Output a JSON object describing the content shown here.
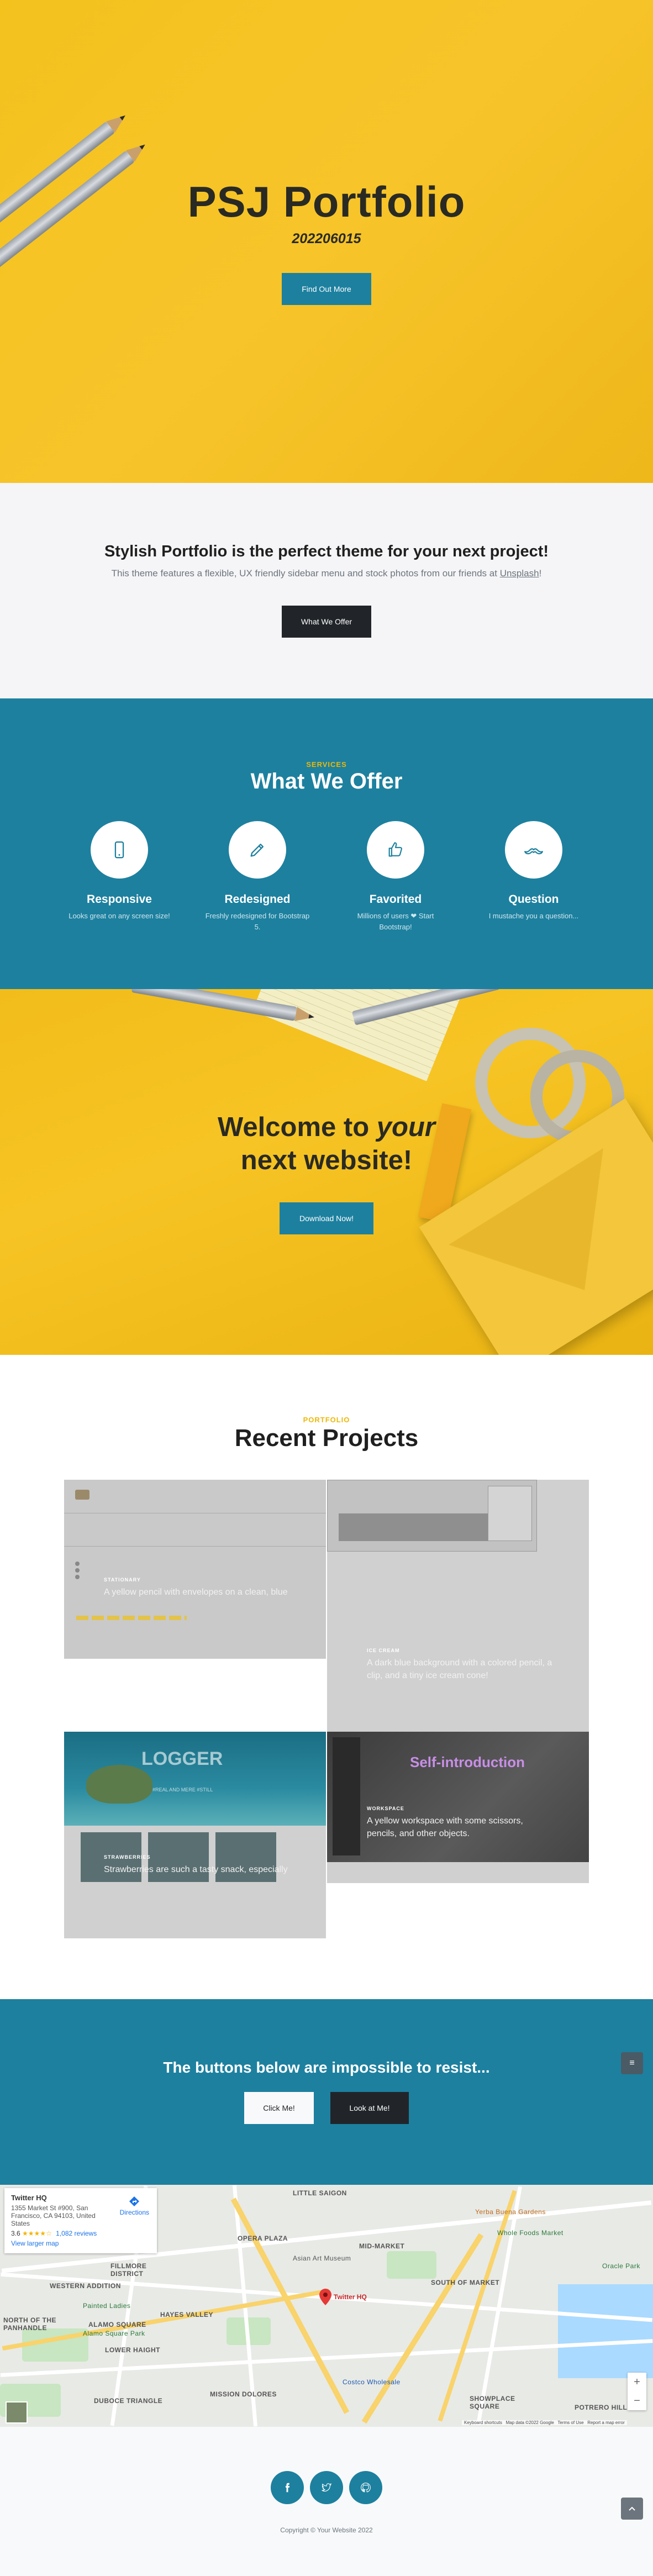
{
  "hero": {
    "title": "PSJ Portfolio",
    "subtitle": "202206015",
    "button": "Find Out More"
  },
  "about": {
    "heading": "Stylish Portfolio is the perfect theme for your next project!",
    "text": "This theme features a flexible, UX friendly sidebar menu and stock photos from our friends at",
    "link": "Unsplash",
    "text_end": "!",
    "button": "What We Offer"
  },
  "services": {
    "eyebrow": "SERVICES",
    "heading": "What We Offer",
    "items": [
      {
        "icon": "phone-icon",
        "title": "Responsive",
        "desc": "Looks great on any screen size!"
      },
      {
        "icon": "pencil-icon",
        "title": "Redesigned",
        "desc": "Freshly redesigned for Bootstrap 5."
      },
      {
        "icon": "thumbs-up-icon",
        "title": "Favorited",
        "desc": "Millions of users ❤ Start Bootstrap!"
      },
      {
        "icon": "mustache-icon",
        "title": "Question",
        "desc": "I mustache you a question..."
      }
    ]
  },
  "callout": {
    "line1": "Welcome to",
    "emph": "your",
    "line2": "next website!",
    "button": "Download Now!"
  },
  "portfolio": {
    "eyebrow": "PORTFOLIO",
    "heading": "Recent Projects",
    "projects": [
      {
        "title": "STATIONARY",
        "desc": "A yellow pencil with envelopes on a clean, blue"
      },
      {
        "title": "ICE CREAM",
        "desc": "A dark blue background with a colored pencil, a clip, and a tiny ice cream cone!"
      },
      {
        "title": "STRAWBERRIES",
        "desc": "Strawberries are such a tasty snack, especially"
      },
      {
        "title": "WORKSPACE",
        "desc": "A yellow workspace with some scissors, pencils, and other objects."
      }
    ],
    "logger_title": "LOGGER",
    "logger_sub": "#REAL AND MERE #STILL",
    "self_intro": "Self-introduction"
  },
  "cta": {
    "heading": "The buttons below are impossible to resist...",
    "button1": "Click Me!",
    "button2": "Look at Me!",
    "menu_icon": "menu-icon"
  },
  "map": {
    "place": "Twitter HQ",
    "address": "1355 Market St #900, San Francisco, CA 94103, United States",
    "rating": "3.6",
    "stars": "★★★★☆",
    "reviews": "1,082 reviews",
    "larger": "View larger map",
    "directions": "Directions",
    "pin_label": "Twitter HQ",
    "footer_text": "Keyboard shortcuts   Map data ©2022 Google   Terms of Use   Report a map error",
    "labels": [
      "LITTLE SAIGON",
      "OPERA PLAZA",
      "MID-MARKET",
      "SOUTH OF MARKET",
      "HAYES VALLEY",
      "ALAMO SQUARE",
      "LOWER HAIGHT",
      "NORTH OF THE PANHANDLE",
      "DUBOCE TRIANGLE",
      "MISSION DOLORES",
      "SHOWPLACE SQUARE",
      "POTRERO HILL",
      "FILLMORE DISTRICT",
      "WESTERN ADDITION",
      "Yerba Buena Gardens",
      "Whole Foods Market",
      "Oracle Park",
      "Costco Wholesale",
      "Asian Art Museum",
      "Painted Ladies",
      "Alamo Square Park"
    ]
  },
  "footer": {
    "icons": [
      "facebook-icon",
      "twitter-icon",
      "github-icon"
    ],
    "copyright": "Copyright © Your Website 2022"
  }
}
